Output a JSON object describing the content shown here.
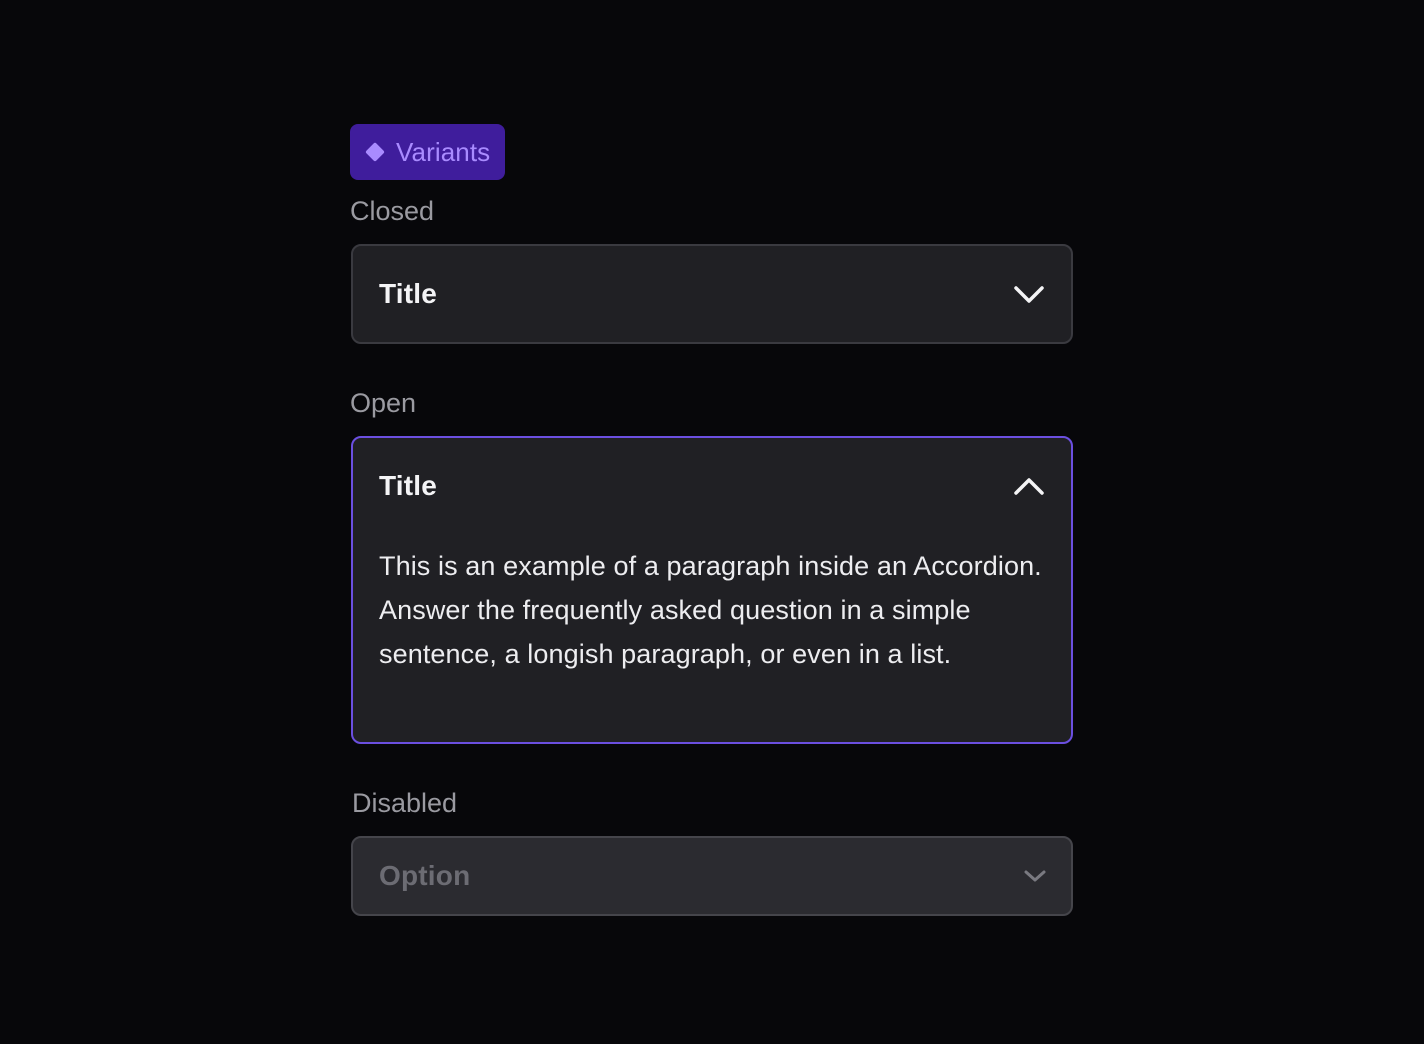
{
  "badge": {
    "label": "Variants",
    "icon": "diamond-icon",
    "background": "#3f1d9c",
    "color": "#a98bff"
  },
  "sections": {
    "closed": {
      "label": "Closed",
      "title": "Title",
      "icon": "chevron-down-icon"
    },
    "open": {
      "label": "Open",
      "title": "Title",
      "icon": "chevron-up-icon",
      "body": "This is an example of a paragraph inside an Accordion. Answer the frequently asked question in a simple sentence, a longish paragraph, or even in a list.",
      "border_color": "#6b4fe0"
    },
    "disabled": {
      "label": "Disabled",
      "title": "Option",
      "icon": "chevron-down-icon"
    }
  },
  "colors": {
    "page_background": "#07070a",
    "panel_background": "#202024",
    "accent": "#6b4fe0"
  }
}
